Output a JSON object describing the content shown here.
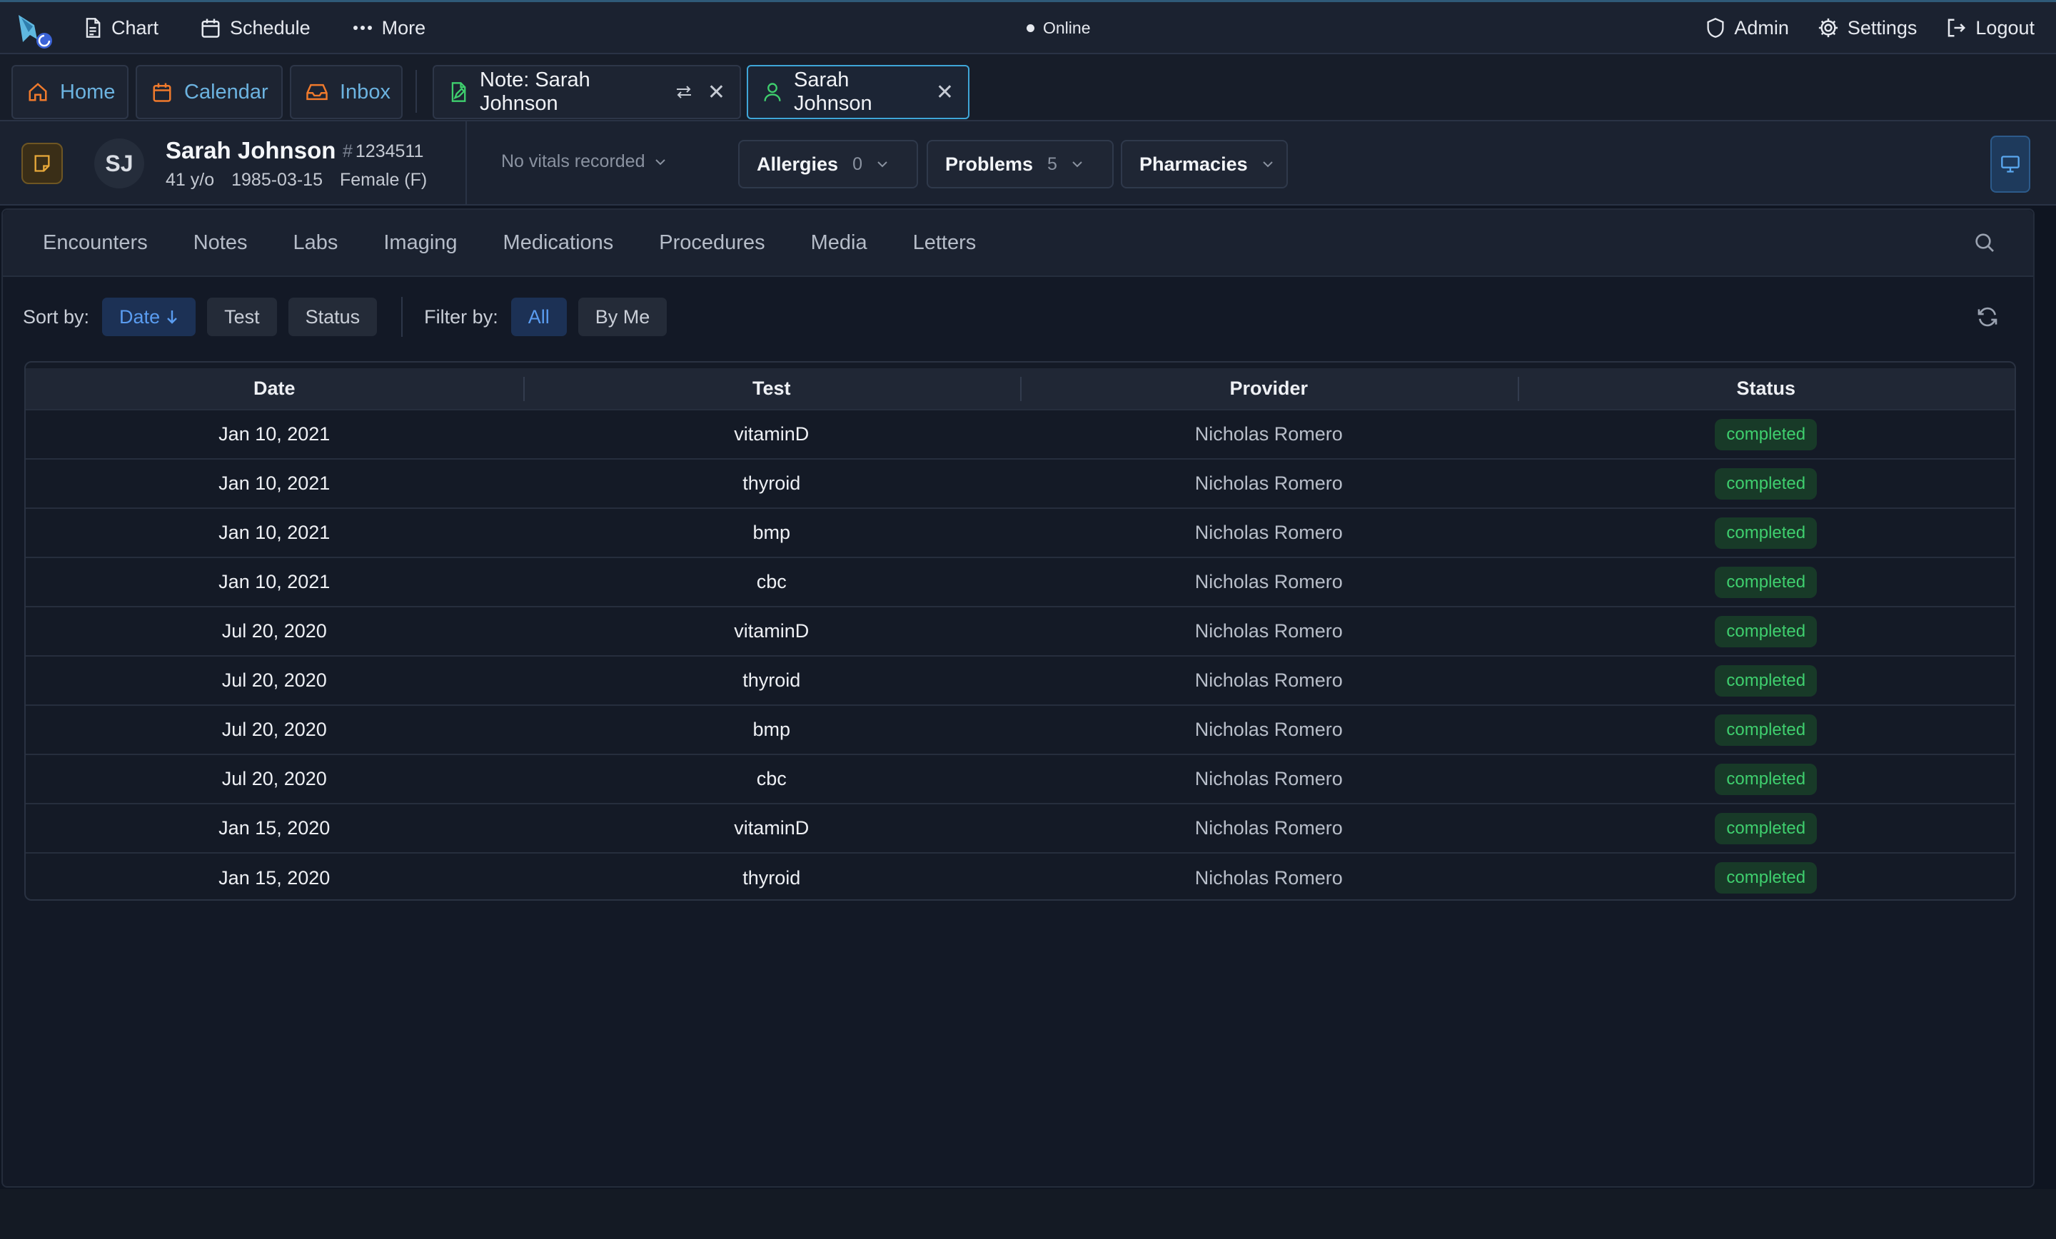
{
  "topbar": {
    "nav": [
      {
        "label": "Chart",
        "icon": "file-text-icon"
      },
      {
        "label": "Schedule",
        "icon": "calendar-icon"
      },
      {
        "label": "More",
        "icon": "more-dots-icon"
      }
    ],
    "status": "Online",
    "right": [
      {
        "label": "Admin",
        "icon": "shield-icon"
      },
      {
        "label": "Settings",
        "icon": "gear-icon"
      },
      {
        "label": "Logout",
        "icon": "logout-icon"
      }
    ]
  },
  "tabs": {
    "home": "Home",
    "calendar": "Calendar",
    "inbox": "Inbox",
    "note": "Note: Sarah Johnson",
    "patient": "Sarah Johnson"
  },
  "patient": {
    "initials": "SJ",
    "name": "Sarah Johnson",
    "mrn": "1234511",
    "age": "41 y/o",
    "dob": "1985-03-15",
    "sex": "Female (F)",
    "vitals": "No vitals recorded",
    "allergies": {
      "label": "Allergies",
      "count": "0"
    },
    "problems": {
      "label": "Problems",
      "count": "5"
    },
    "pharmacies": {
      "label": "Pharmacies"
    }
  },
  "subtabs": [
    "Encounters",
    "Notes",
    "Labs",
    "Imaging",
    "Medications",
    "Procedures",
    "Media",
    "Letters"
  ],
  "toolbar": {
    "sort_label": "Sort by:",
    "sort_options": [
      "Date",
      "Test",
      "Status"
    ],
    "sort_active": "Date",
    "filter_label": "Filter by:",
    "filter_options": [
      "All",
      "By Me"
    ],
    "filter_active": "All"
  },
  "table": {
    "columns": [
      "Date",
      "Test",
      "Provider",
      "Status"
    ],
    "rows": [
      {
        "date": "Jan 10, 2021",
        "test": "vitaminD",
        "provider": "Nicholas Romero",
        "status": "completed"
      },
      {
        "date": "Jan 10, 2021",
        "test": "thyroid",
        "provider": "Nicholas Romero",
        "status": "completed"
      },
      {
        "date": "Jan 10, 2021",
        "test": "bmp",
        "provider": "Nicholas Romero",
        "status": "completed"
      },
      {
        "date": "Jan 10, 2021",
        "test": "cbc",
        "provider": "Nicholas Romero",
        "status": "completed"
      },
      {
        "date": "Jul 20, 2020",
        "test": "vitaminD",
        "provider": "Nicholas Romero",
        "status": "completed"
      },
      {
        "date": "Jul 20, 2020",
        "test": "thyroid",
        "provider": "Nicholas Romero",
        "status": "completed"
      },
      {
        "date": "Jul 20, 2020",
        "test": "bmp",
        "provider": "Nicholas Romero",
        "status": "completed"
      },
      {
        "date": "Jul 20, 2020",
        "test": "cbc",
        "provider": "Nicholas Romero",
        "status": "completed"
      },
      {
        "date": "Jan 15, 2020",
        "test": "vitaminD",
        "provider": "Nicholas Romero",
        "status": "completed"
      },
      {
        "date": "Jan 15, 2020",
        "test": "thyroid",
        "provider": "Nicholas Romero",
        "status": "completed"
      }
    ]
  },
  "colors": {
    "accent": "#3fa6d8",
    "status_completed": "#3fcf6e",
    "sort_active": "#5a9cf0"
  }
}
